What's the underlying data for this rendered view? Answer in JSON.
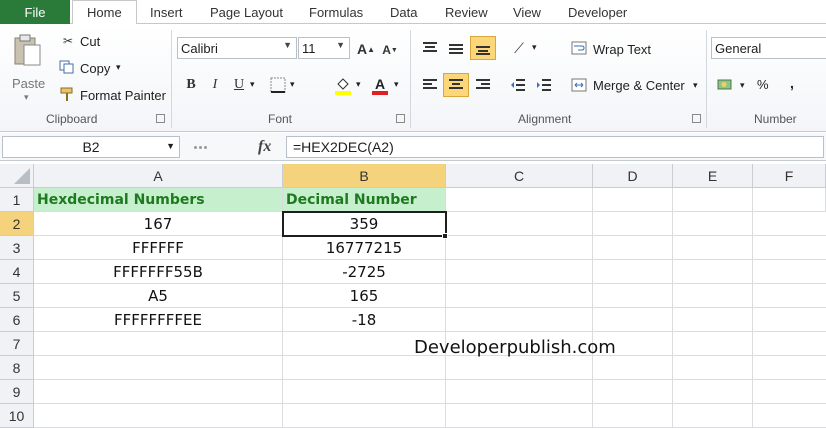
{
  "tabs": {
    "file": "File",
    "home": "Home",
    "insert": "Insert",
    "page_layout": "Page Layout",
    "formulas": "Formulas",
    "data": "Data",
    "review": "Review",
    "view": "View",
    "developer": "Developer"
  },
  "clipboard": {
    "paste": "Paste",
    "cut": "Cut",
    "copy": "Copy",
    "format_painter": "Format Painter",
    "label": "Clipboard"
  },
  "font": {
    "name": "Calibri",
    "size": "11",
    "label": "Font",
    "bold": "B",
    "italic": "I",
    "underline": "U"
  },
  "alignment": {
    "wrap_text": "Wrap Text",
    "merge_center": "Merge & Center",
    "label": "Alignment"
  },
  "number": {
    "format": "General",
    "label": "Number",
    "percent": "%"
  },
  "formula_bar": {
    "name_box": "B2",
    "fx": "fx",
    "formula": "=HEX2DEC(A2)"
  },
  "columns": [
    "A",
    "B",
    "C",
    "D",
    "E",
    "F"
  ],
  "rows": [
    "1",
    "2",
    "3",
    "4",
    "5",
    "6",
    "7",
    "8",
    "9",
    "10"
  ],
  "sheet": {
    "A1": "Hexdecimal Numbers",
    "B1": "Decimal Number",
    "A2": "167",
    "B2": "359",
    "A3": "FFFFFF",
    "B3": "16777215",
    "A4": "FFFFFFF55B",
    "B4": "-2725",
    "A5": "A5",
    "B5": "165",
    "A6": "FFFFFFFFEE",
    "B6": "-18"
  },
  "watermark": "Developerpublish.com",
  "colors": {
    "file_tab": "#2a7a3a",
    "header_fill": "#c6efce",
    "header_text": "#1e7a1e",
    "selected_header": "#f5d27c"
  }
}
